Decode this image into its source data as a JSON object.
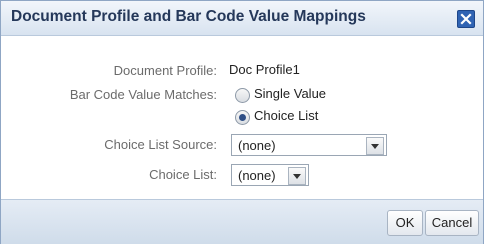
{
  "dialog": {
    "title": "Document Profile and Bar Code Value Mappings",
    "close_icon": "close-icon"
  },
  "form": {
    "document_profile_label": "Document Profile:",
    "document_profile_value": "Doc Profile1",
    "bar_code_matches_label": "Bar Code Value Matches:",
    "options": [
      {
        "label": "Single Value",
        "selected": false
      },
      {
        "label": "Choice List",
        "selected": true
      }
    ],
    "choice_list_source_label": "Choice List Source:",
    "choice_list_source_value": "(none)",
    "choice_list_label": "Choice List:",
    "choice_list_value": "(none)"
  },
  "footer": {
    "ok_label": "OK",
    "cancel_label": "Cancel"
  },
  "colors": {
    "title_text": "#25385a",
    "close_button": "#2f63b3",
    "label_text": "#6b6b6b"
  }
}
